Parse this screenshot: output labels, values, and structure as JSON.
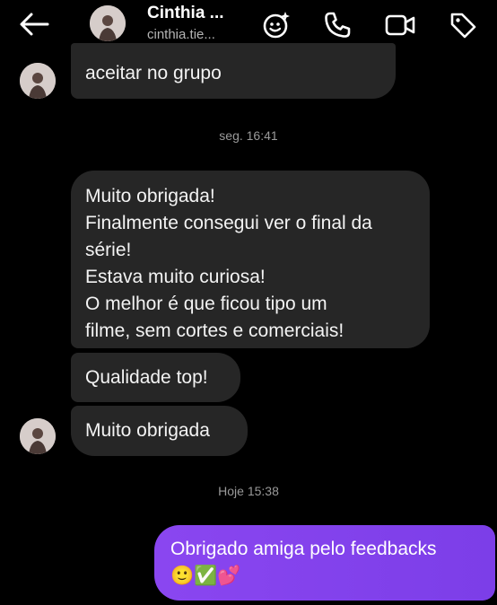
{
  "header": {
    "contact_name": "Cinthia ...",
    "contact_username": "cinthia.tie...",
    "icons": [
      "back-arrow-icon",
      "effects-icon",
      "phone-icon",
      "video-camera-icon",
      "tag-icon"
    ]
  },
  "messages": {
    "first_in": "aceitar no grupo",
    "timestamp_1": "seg. 16:41",
    "long_in": {
      "line1": "Muito obrigada!",
      "line2": "Finalmente consegui ver o final da",
      "line3": "série!",
      "line4": "Estava muito curiosa!",
      "line5": "O melhor é que ficou tipo um",
      "line6": "filme, sem cortes e comerciais!"
    },
    "quality_in": "Qualidade top!",
    "thanks_in": "Muito obrigada",
    "timestamp_2": "Hoje 15:38",
    "out": {
      "line1": "Obrigado amiga pelo feedbacks",
      "line2": "🙂✅💕"
    }
  },
  "colors": {
    "background": "#000000",
    "incoming_bubble": "#262626",
    "outgoing_bubble": "#8a46f0",
    "timestamp": "#9a9a9a"
  }
}
